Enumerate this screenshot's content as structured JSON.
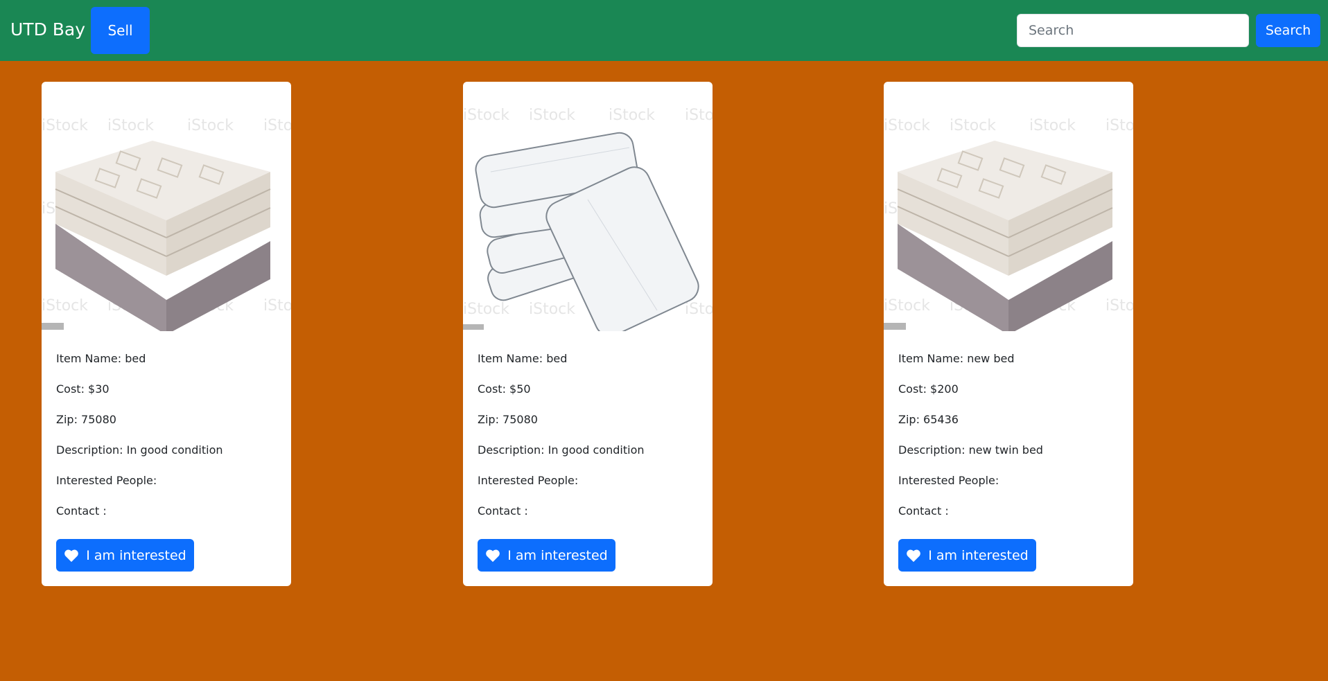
{
  "navbar": {
    "brand": "UTD Bay",
    "sell_label": "Sell",
    "search_placeholder": "Search",
    "search_button": "Search",
    "background": "#1a8754",
    "accent": "#0d6efd"
  },
  "page": {
    "background": "#c45e03"
  },
  "listings": [
    {
      "item_name": "Item Name: bed",
      "cost": "Cost: $30",
      "zip": "Zip: 75080",
      "description": "Description: In good condition",
      "interested": "Interested People:",
      "contact": "Contact :",
      "button": "I am interested",
      "image": "stacked-mattress-photo"
    },
    {
      "item_name": "Item Name: bed",
      "cost": "Cost: $50",
      "zip": "Zip: 75080",
      "description": "Description: In good condition",
      "interested": "Interested People:",
      "contact": "Contact :",
      "button": "I am interested",
      "image": "pile-of-mattresses-photo"
    },
    {
      "item_name": "Item Name: new bed",
      "cost": "Cost: $200",
      "zip": "Zip: 65436",
      "description": "Description: new twin bed",
      "interested": "Interested People:",
      "contact": "Contact :",
      "button": "I am interested",
      "image": "stacked-mattress-photo"
    }
  ]
}
